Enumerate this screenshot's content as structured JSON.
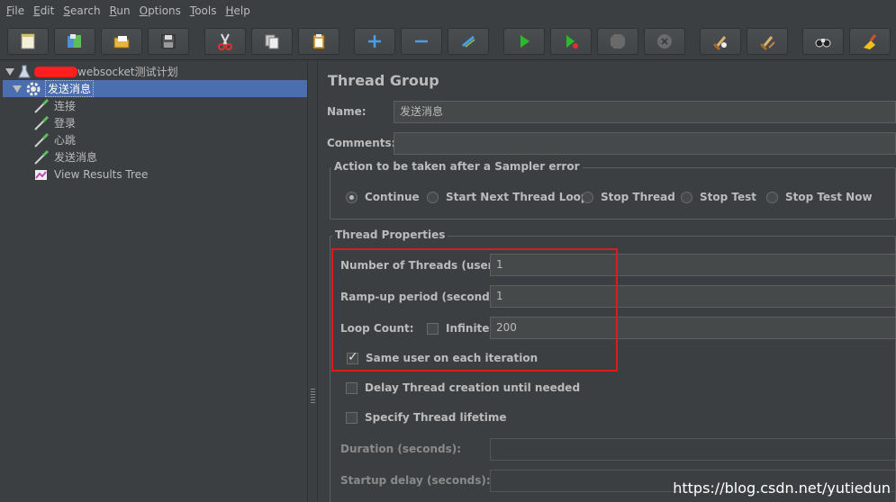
{
  "menu": [
    {
      "mnemonic": "F",
      "rest": "ile"
    },
    {
      "mnemonic": "E",
      "rest": "dit"
    },
    {
      "mnemonic": "S",
      "rest": "earch"
    },
    {
      "mnemonic": "R",
      "rest": "un"
    },
    {
      "mnemonic": "O",
      "rest": "ptions"
    },
    {
      "mnemonic": "T",
      "rest": "ools"
    },
    {
      "mnemonic": "H",
      "rest": "elp"
    }
  ],
  "toolbar": {
    "buttons": [
      "new-icon",
      "templates-icon",
      "open-icon",
      "save-icon",
      "cut-icon",
      "copy-icon",
      "paste-icon",
      "expand-icon",
      "collapse-icon",
      "toggle-icon",
      "start-icon",
      "start-no-pause-icon",
      "stop-icon",
      "shutdown-icon",
      "clear-icon",
      "clear-all-icon",
      "search-icon",
      "reset-search-icon"
    ]
  },
  "tree": {
    "plan_suffix": "websocket测试计划",
    "thread_group": "发送消息",
    "children": [
      "连接",
      "登录",
      "心跳",
      "发送消息",
      "View Results Tree"
    ]
  },
  "panel": {
    "title": "Thread Group",
    "name_label": "Name:",
    "name_value": "发送消息",
    "comments_label": "Comments:",
    "comments_value": "",
    "error_action": {
      "legend": "Action to be taken after a Sampler error",
      "options": [
        "Continue",
        "Start Next Thread Loop",
        "Stop Thread",
        "Stop Test",
        "Stop Test Now"
      ],
      "selected": "Continue"
    },
    "thread_props": {
      "legend": "Thread Properties",
      "threads_label": "Number of Threads (users):",
      "threads_value": "1",
      "rampup_label": "Ramp-up period (seconds):",
      "rampup_value": "1",
      "loop_label": "Loop Count:",
      "infinite_label": "Infinite",
      "infinite_checked": false,
      "loop_value": "200",
      "same_user_label": "Same user on each iteration",
      "same_user_checked": true,
      "delay_label": "Delay Thread creation until needed",
      "delay_checked": false,
      "lifetime_label": "Specify Thread lifetime",
      "lifetime_checked": false,
      "duration_label": "Duration (seconds):",
      "duration_value": "",
      "startup_label": "Startup delay (seconds):",
      "startup_value": ""
    }
  },
  "watermark": "https://blog.csdn.net/yutiedun",
  "colors": {
    "background": "#3c3f41",
    "selection": "#4b6eaf",
    "highlight_box": "#e0191d",
    "redaction": "#ff1d1d"
  }
}
